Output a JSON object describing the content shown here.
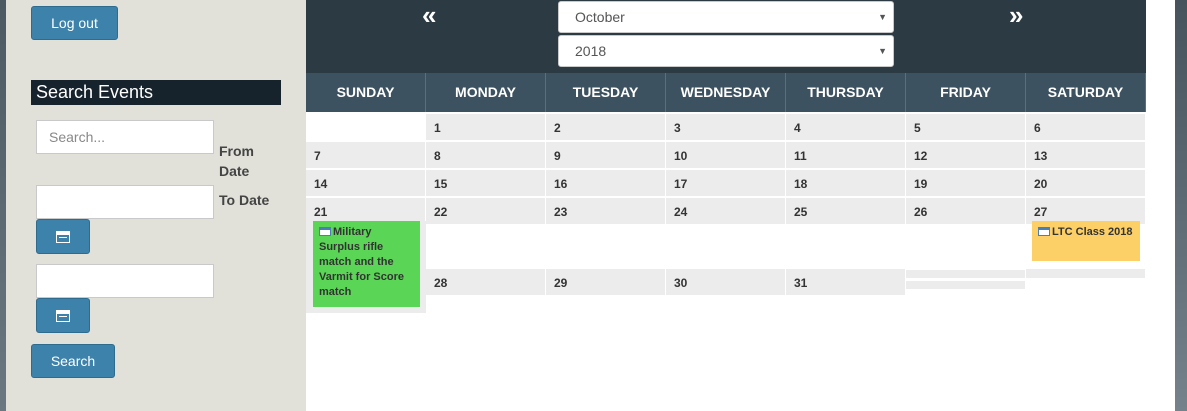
{
  "sidebar": {
    "logout_label": "Log out",
    "search_events_title": "Search Events",
    "search_placeholder": "Search...",
    "from_date_label": "From Date",
    "to_date_label": "To Date",
    "search_button_label": "Search"
  },
  "calendar": {
    "month": "October",
    "year": "2018",
    "prev_symbol": "«",
    "next_symbol": "»",
    "days": [
      "SUNDAY",
      "MONDAY",
      "TUESDAY",
      "WEDNESDAY",
      "THURSDAY",
      "FRIDAY",
      "SATURDAY"
    ],
    "weeks": [
      [
        "",
        "1",
        "2",
        "3",
        "4",
        "5",
        "6"
      ],
      [
        "7",
        "8",
        "9",
        "10",
        "11",
        "12",
        "13"
      ],
      [
        "14",
        "15",
        "16",
        "17",
        "18",
        "19",
        "20"
      ],
      [
        "21",
        "22",
        "23",
        "24",
        "25",
        "26",
        "27"
      ],
      [
        "",
        "28",
        "29",
        "30",
        "31",
        "",
        ""
      ]
    ],
    "events": [
      {
        "title": "Military Surplus rifle match and the Varmit for Score match",
        "date": "21",
        "color": "#5ad556"
      },
      {
        "title": "LTC Class 2018",
        "date": "27",
        "color": "#fcd066"
      }
    ]
  },
  "colors": {
    "accent_button": "#3d82ab",
    "header_dark": "#2c3a44",
    "dayheader": "#3d5260",
    "sidebar_bg": "#e1e1da"
  }
}
